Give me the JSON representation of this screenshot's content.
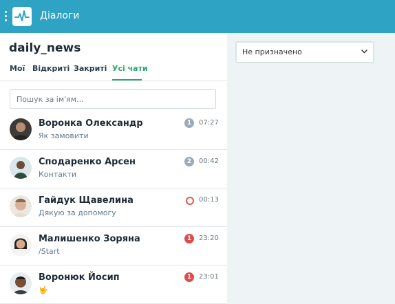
{
  "app": {
    "title": "Діалоги"
  },
  "header": {
    "title": "daily_news"
  },
  "tabs": [
    {
      "label": "Мої"
    },
    {
      "label": "Відкриті"
    },
    {
      "label": "Закриті"
    },
    {
      "label": "Усі чати",
      "active": true
    }
  ],
  "search": {
    "placeholder": "Пошук за ім'ям..."
  },
  "assignee": {
    "value": "Не призначено"
  },
  "chats": [
    {
      "name": "Воронка Олександр",
      "preview": "Як замовити",
      "time": "07:27",
      "badge": "1",
      "badge_type": "gray"
    },
    {
      "name": "Сподаренко Арсен",
      "preview": "Контакти",
      "time": "00:42",
      "badge": "2",
      "badge_type": "gray"
    },
    {
      "name": "Гайдук Щавелина",
      "preview": "Дякую за допомогу",
      "time": "00:13",
      "badge": "",
      "badge_type": "ring"
    },
    {
      "name": "Малишенко Зоряна",
      "preview": "/Start",
      "time": "23:20",
      "badge": "1",
      "badge_type": "red"
    },
    {
      "name": "Воронюк Йосип",
      "preview": "🤟",
      "time": "23:01",
      "badge": "1",
      "badge_type": "red"
    }
  ],
  "colors": {
    "topbar": "#2ea3c4",
    "accent": "#2aa86a",
    "badge_red": "#e04b4b",
    "badge_gray": "#9aabb8"
  }
}
